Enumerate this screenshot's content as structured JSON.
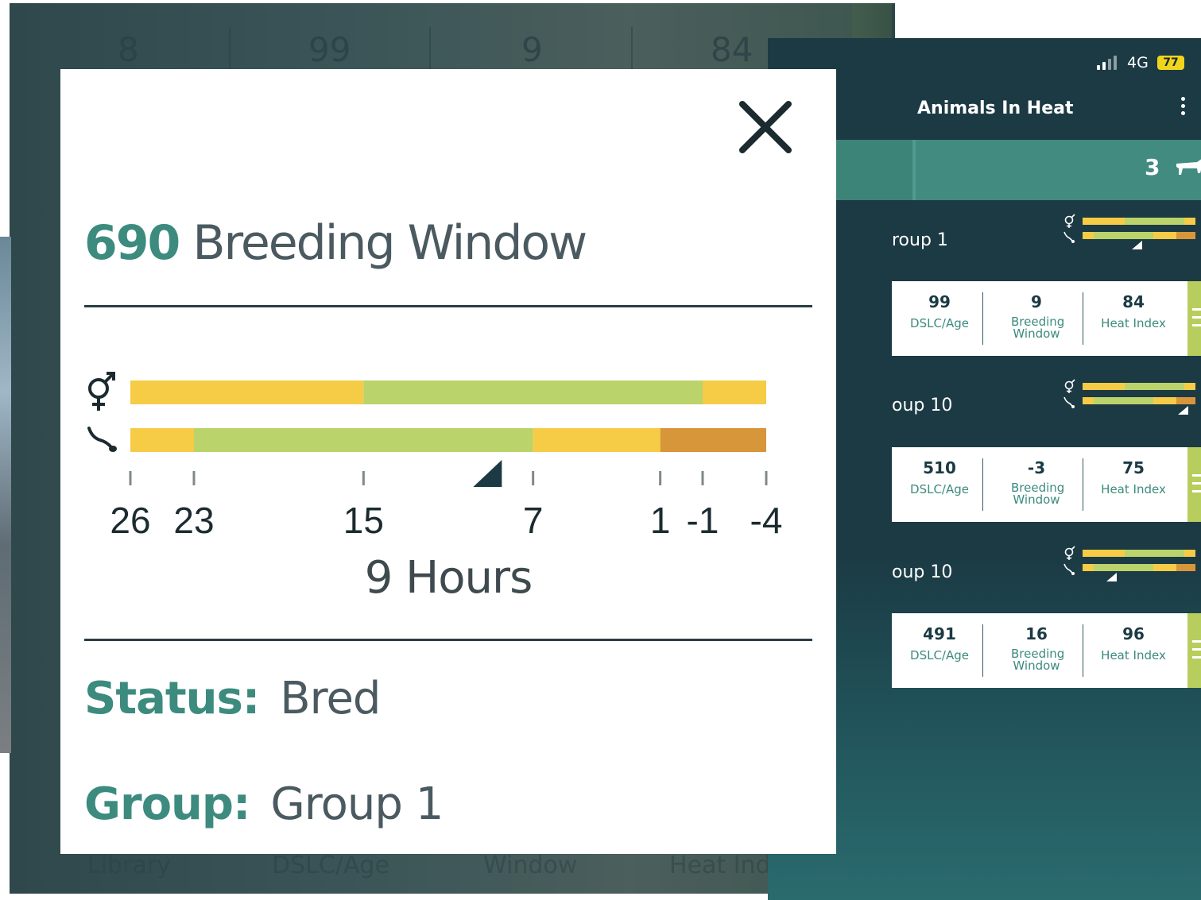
{
  "phone": {
    "status": {
      "network": "4G",
      "battery": "77"
    },
    "appbar": {
      "title": "Animals In Heat"
    },
    "count": "3",
    "groups": [
      {
        "name": "roup 1",
        "dslc": "99",
        "dslc_label": "DSLC/Age",
        "window": "9",
        "window_label": "Breeding Window",
        "heat": "84",
        "heat_label": "Heat Index"
      },
      {
        "name": "oup 10",
        "dslc": "510",
        "dslc_label": "DSLC/Age",
        "window": "-3",
        "window_label": "Breeding Window",
        "heat": "75",
        "heat_label": "Heat Index"
      },
      {
        "name": "oup 10",
        "dslc": "491",
        "dslc_label": "DSLC/Age",
        "window": "16",
        "window_label": "Breeding Window",
        "heat": "96",
        "heat_label": "Heat Index"
      }
    ]
  },
  "background": {
    "top_numbers": [
      "8",
      "99",
      "9",
      "84"
    ],
    "bottom_labels": [
      "Library",
      "DSLC/Age",
      "Window",
      "Heat Index"
    ]
  },
  "modal": {
    "animal_id": "690",
    "title": "Breeding Window",
    "hours_label": "9 Hours",
    "status_key": "Status:",
    "status_value": "Bred",
    "group_key": "Group:",
    "group_value": "Group 1",
    "icons": [
      "female-male-icon",
      "sperm-icon",
      "close-icon"
    ]
  },
  "colors": {
    "teal": "#3c8b7e",
    "yellow": "#f6cb46",
    "green": "#bbd36b",
    "orange": "#d8963b",
    "dark": "#1b3a44"
  },
  "chart_data": {
    "type": "bar",
    "ticks": [
      "26",
      "23",
      "15",
      "7",
      "1",
      "-1",
      "-4"
    ],
    "tick_values": [
      26,
      23,
      15,
      7,
      1,
      -1,
      -4
    ],
    "axis_range": [
      26,
      -4
    ],
    "current_marker_hours": 9,
    "series": [
      {
        "segments": [
          {
            "from": 26,
            "to": 15,
            "color": "yellow"
          },
          {
            "from": 15,
            "to": -1,
            "color": "green"
          },
          {
            "from": -1,
            "to": -4,
            "color": "yellow"
          }
        ]
      },
      {
        "segments": [
          {
            "from": 26,
            "to": 23,
            "color": "yellow"
          },
          {
            "from": 23,
            "to": 7,
            "color": "green"
          },
          {
            "from": 7,
            "to": 1,
            "color": "yellow"
          },
          {
            "from": 1,
            "to": -4,
            "color": "orange"
          }
        ]
      }
    ]
  }
}
